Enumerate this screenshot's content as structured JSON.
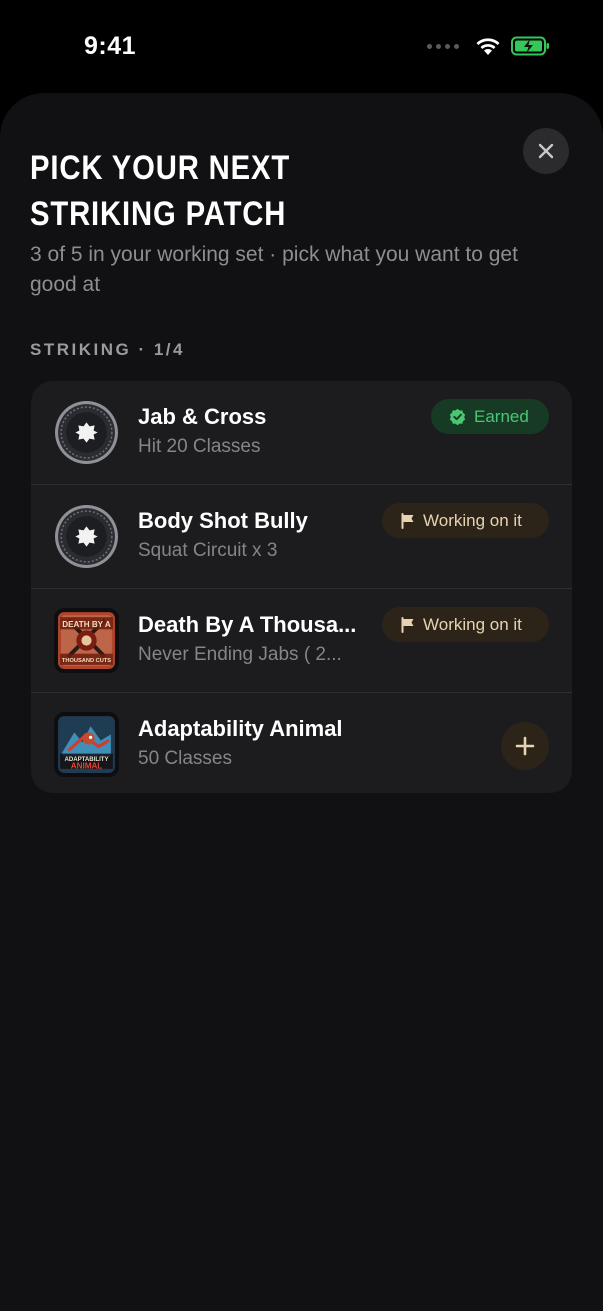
{
  "status_bar": {
    "time": "9:41",
    "icons": [
      "signal-icon",
      "wifi-icon",
      "battery-charging-icon"
    ],
    "battery_color": "#34c759"
  },
  "sheet": {
    "title": "PICK YOUR NEXT STRIKING PATCH",
    "subtitle": "3 of 5 in your working set · pick what you want to get good at",
    "close_icon": "close-icon"
  },
  "section": {
    "label": "STRIKING · 1/4"
  },
  "patches": [
    {
      "title": "Jab & Cross",
      "subtitle": "Hit 20 Classes",
      "patch_icon": "locked-badge-icon",
      "status": "Earned",
      "status_icon": "verified-check-icon"
    },
    {
      "title": "Body Shot Bully",
      "subtitle": "Squat Circuit x 3",
      "patch_icon": "locked-badge-icon",
      "status": "Working on it",
      "status_icon": "flag-icon"
    },
    {
      "title": "Death By A Thousa...",
      "subtitle": "Never Ending Jabs ( 2...",
      "patch_icon": "death-by-a-thousand-cuts-patch",
      "patch_text_top": "DEATH BY A",
      "patch_text_bottom": "THOUSAND CUTS",
      "status": "Working on it",
      "status_icon": "flag-icon"
    },
    {
      "title": "Adaptability Animal",
      "subtitle": "50 Classes",
      "patch_icon": "adaptability-animal-patch",
      "patch_text_top": "ADAPTABILITY",
      "patch_text_bottom": "ANIMAL",
      "action_icon": "plus-icon"
    }
  ],
  "colors": {
    "background": "#000000",
    "sheet": "#111113",
    "card": "#1c1c1f",
    "earned_bg": "#173a25",
    "earned_text": "#49c774",
    "working_bg": "#2c2418",
    "working_text": "#e7d3b1"
  }
}
